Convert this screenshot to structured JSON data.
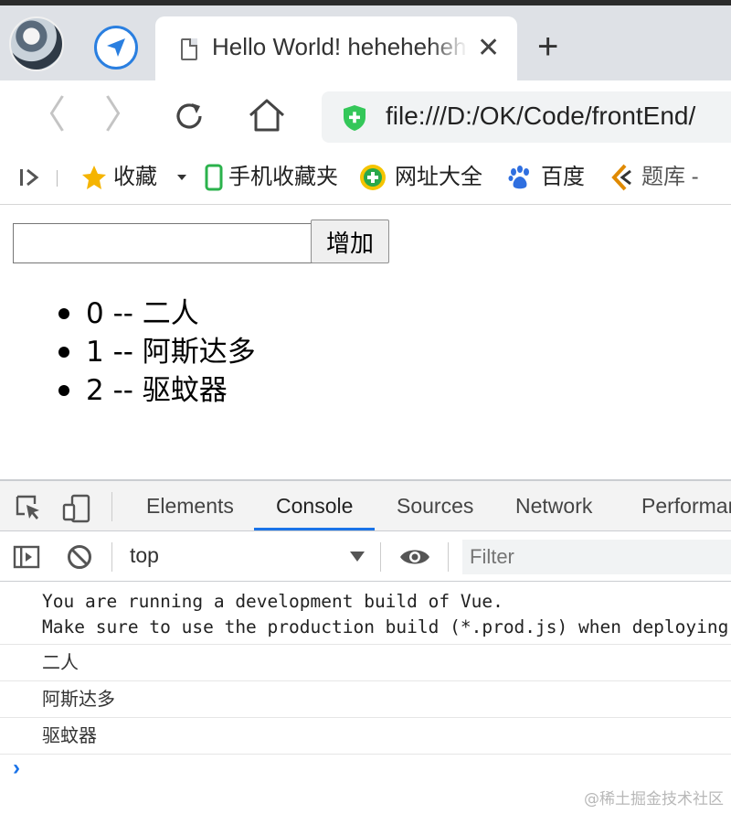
{
  "browser": {
    "tab": {
      "title": "Hello World! hehehehehe",
      "close_glyph": "✕"
    },
    "new_tab_glyph": "+",
    "nav": {
      "back_glyph": "〈",
      "forward_glyph": "〉"
    },
    "address_bar": {
      "url": "file:///D:/OK/Code/frontEnd/"
    },
    "bookmarks": [
      {
        "label": "收藏",
        "icon": "star-icon"
      },
      {
        "label": "手机收藏夹",
        "icon": "phone-icon"
      },
      {
        "label": "网址大全",
        "icon": "plus-globe-icon"
      },
      {
        "label": "百度",
        "icon": "paw-icon"
      },
      {
        "label": "题库 -",
        "icon": "chevron-logo-icon"
      }
    ]
  },
  "page": {
    "input": {
      "value": ""
    },
    "add_button_label": "增加",
    "todos": [
      "0 -- 二人",
      "1 -- 阿斯达多",
      "2 -- 驱蚊器"
    ]
  },
  "devtools": {
    "tabs": [
      "Elements",
      "Console",
      "Sources",
      "Network",
      "Performance"
    ],
    "active_tab": "Console",
    "context": "top",
    "filter_placeholder": "Filter",
    "logs": {
      "vue_warning_line1": "You are running a development build of Vue.",
      "vue_warning_line2": "Make sure to use the production build (*.prod.js) when deploying for production.",
      "items": [
        "二人",
        "阿斯达多",
        "驱蚊器"
      ]
    },
    "prompt_glyph": "›"
  },
  "watermark": "@稀土掘金技术社区",
  "colors": {
    "accent": "#1a73e8",
    "tab_strip": "#dee1e6",
    "secure_shield": "#34c759"
  }
}
